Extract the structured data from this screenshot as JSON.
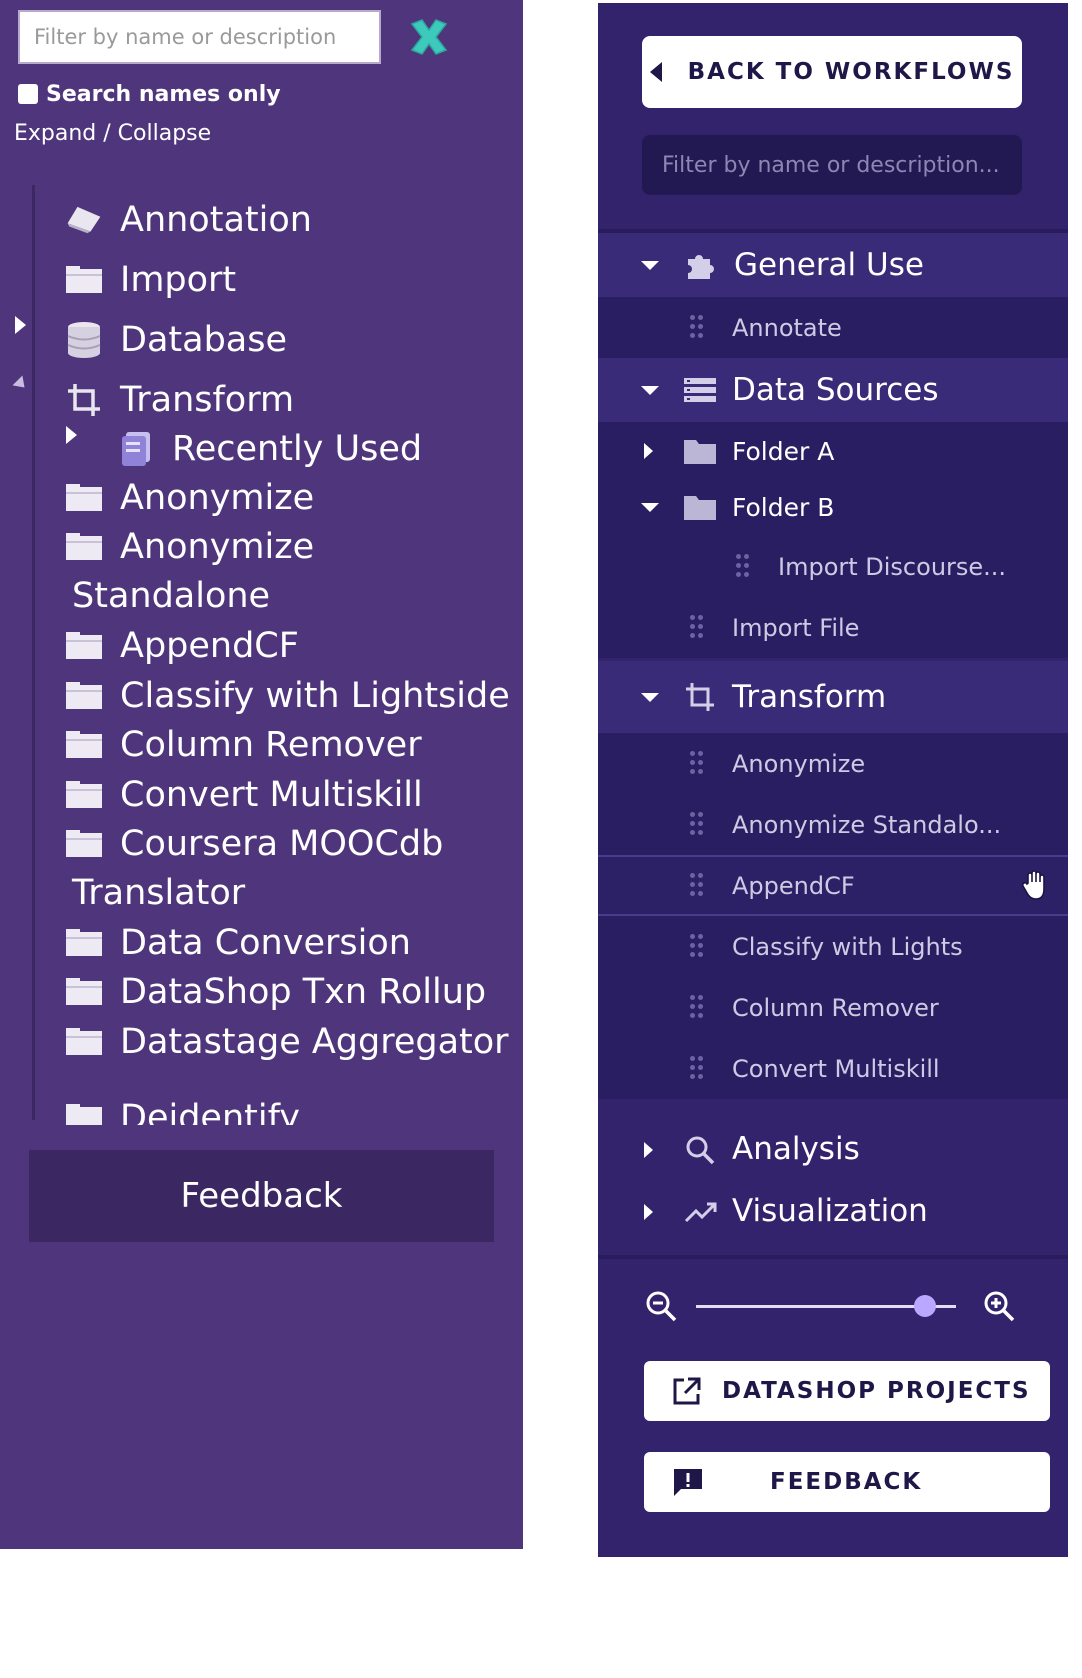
{
  "left_panel": {
    "filter_placeholder": "Filter by name or description",
    "search_names_only": "Search names only",
    "expand_collapse": "Expand / Collapse",
    "tree": {
      "annotation": "Annotation",
      "import": "Import",
      "database": "Database",
      "transform": "Transform",
      "recently_used": "Recently Used",
      "anonymize": "Anonymize",
      "anonymize_standalone_1": "Anonymize",
      "anonymize_standalone_2": "Standalone",
      "appendcf": "AppendCF",
      "classify_lightside": "Classify with Lightside",
      "column_remover": "Column Remover",
      "convert_multiskill": "Convert Multiskill",
      "coursera_1": "Coursera MOOCdb",
      "coursera_2": "Translator",
      "data_conversion": "Data Conversion",
      "datashop_txn_rollup": "DataShop Txn Rollup",
      "datastage_aggregator": "Datastage Aggregator",
      "deidentify_partial": "Deidentify"
    },
    "feedback": "Feedback"
  },
  "right_panel": {
    "back_to_workflows": "BACK TO WORKFLOWS",
    "filter_placeholder": "Filter by name or description...",
    "general_use": "General Use",
    "annotate": "Annotate",
    "data_sources": "Data Sources",
    "folder_a": "Folder A",
    "folder_b": "Folder B",
    "import_discourse": "Import Discourse...",
    "import_file": "Import File",
    "transform": "Transform",
    "anonymize": "Anonymize",
    "anonymize_standalone": "Anonymize Standalo...",
    "appendcf": "AppendCF",
    "classify_lights": "Classify with Lights",
    "column_remover": "Column Remover",
    "convert_multiskill": "Convert Multiskill",
    "analysis": "Analysis",
    "visualization": "Visualization",
    "datashop_projects": "DATASHOP PROJECTS",
    "feedback": "FEEDBACK",
    "zoom_level": 0.88
  },
  "colors": {
    "left_bg": "#4f367c",
    "right_bg": "#32236c",
    "accent_teal": "#3ec9bd",
    "zoom_knob": "#b9a8ff"
  }
}
